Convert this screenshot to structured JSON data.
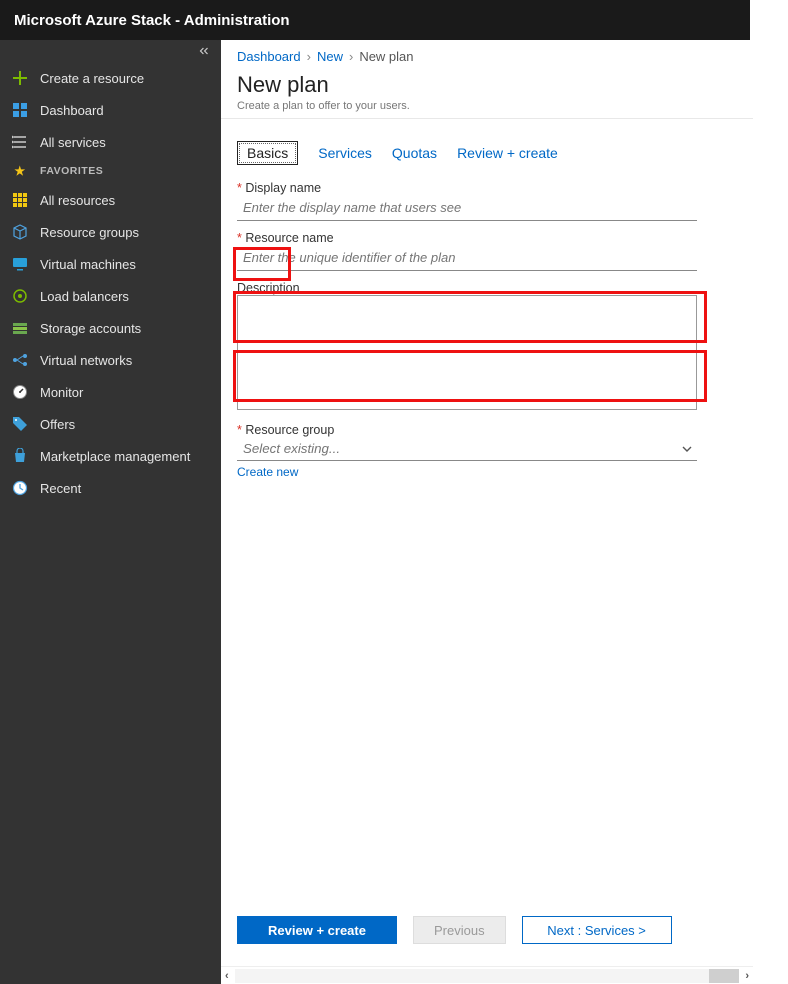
{
  "header": {
    "title": "Microsoft Azure Stack - Administration"
  },
  "sidebar": {
    "create": "Create a resource",
    "dashboard": "Dashboard",
    "allservices": "All services",
    "favorites_label": "FAVORITES",
    "items": [
      {
        "label": "All resources"
      },
      {
        "label": "Resource groups"
      },
      {
        "label": "Virtual machines"
      },
      {
        "label": "Load balancers"
      },
      {
        "label": "Storage accounts"
      },
      {
        "label": "Virtual networks"
      },
      {
        "label": "Monitor"
      },
      {
        "label": "Offers"
      },
      {
        "label": "Marketplace management"
      },
      {
        "label": "Recent"
      }
    ]
  },
  "breadcrumb": {
    "a": "Dashboard",
    "b": "New",
    "c": "New plan"
  },
  "page": {
    "title": "New plan",
    "subtitle": "Create a plan to offer to your users."
  },
  "tabs": {
    "basics": "Basics",
    "services": "Services",
    "quotas": "Quotas",
    "review": "Review + create"
  },
  "form": {
    "display_name_label": "Display name",
    "display_name_placeholder": "Enter the display name that users see",
    "resource_name_label": "Resource name",
    "resource_name_placeholder": "Enter the unique identifier of the plan",
    "description_label": "Description",
    "resource_group_label": "Resource group",
    "resource_group_placeholder": "Select existing...",
    "create_new": "Create new"
  },
  "footer": {
    "review": "Review + create",
    "previous": "Previous",
    "next": "Next : Services >"
  }
}
